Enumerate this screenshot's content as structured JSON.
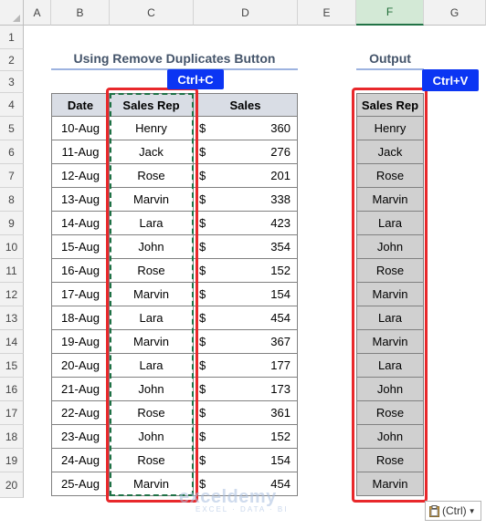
{
  "columns": [
    "A",
    "B",
    "C",
    "D",
    "E",
    "F",
    "G"
  ],
  "rows": [
    "1",
    "2",
    "3",
    "4",
    "5",
    "6",
    "7",
    "8",
    "9",
    "10",
    "11",
    "12",
    "13",
    "14",
    "15",
    "16",
    "17",
    "18",
    "19",
    "20"
  ],
  "title_left": "Using Remove Duplicates Button",
  "title_right": "Output",
  "badge_copy": "Ctrl+C",
  "badge_paste": "Ctrl+V",
  "headers": {
    "date": "Date",
    "rep": "Sales Rep",
    "sales": "Sales"
  },
  "currency": "$",
  "table": [
    {
      "date": "10-Aug",
      "rep": "Henry",
      "sales": "360"
    },
    {
      "date": "11-Aug",
      "rep": "Jack",
      "sales": "276"
    },
    {
      "date": "12-Aug",
      "rep": "Rose",
      "sales": "201"
    },
    {
      "date": "13-Aug",
      "rep": "Marvin",
      "sales": "338"
    },
    {
      "date": "14-Aug",
      "rep": "Lara",
      "sales": "423"
    },
    {
      "date": "15-Aug",
      "rep": "John",
      "sales": "354"
    },
    {
      "date": "16-Aug",
      "rep": "Rose",
      "sales": "152"
    },
    {
      "date": "17-Aug",
      "rep": "Marvin",
      "sales": "154"
    },
    {
      "date": "18-Aug",
      "rep": "Lara",
      "sales": "454"
    },
    {
      "date": "19-Aug",
      "rep": "Marvin",
      "sales": "367"
    },
    {
      "date": "20-Aug",
      "rep": "Lara",
      "sales": "177"
    },
    {
      "date": "21-Aug",
      "rep": "John",
      "sales": "173"
    },
    {
      "date": "22-Aug",
      "rep": "Rose",
      "sales": "361"
    },
    {
      "date": "23-Aug",
      "rep": "John",
      "sales": "152"
    },
    {
      "date": "24-Aug",
      "rep": "Rose",
      "sales": "154"
    },
    {
      "date": "25-Aug",
      "rep": "Marvin",
      "sales": "454"
    }
  ],
  "output_header": "Sales Rep",
  "output": [
    "Henry",
    "Jack",
    "Rose",
    "Marvin",
    "Lara",
    "John",
    "Rose",
    "Marvin",
    "Lara",
    "Marvin",
    "Lara",
    "John",
    "Rose",
    "John",
    "Rose",
    "Marvin"
  ],
  "paste_options": {
    "label": "(Ctrl)",
    "icon": "clipboard-icon"
  },
  "watermark": {
    "name": "exceldemy",
    "tagline": "EXCEL · DATA · BI"
  },
  "colors": {
    "accent_red": "#e8282b",
    "badge_blue": "#0b35f3",
    "copy_dash": "#1e7145",
    "header_fill": "#d9dde5",
    "output_fill": "#d0d0d0"
  }
}
